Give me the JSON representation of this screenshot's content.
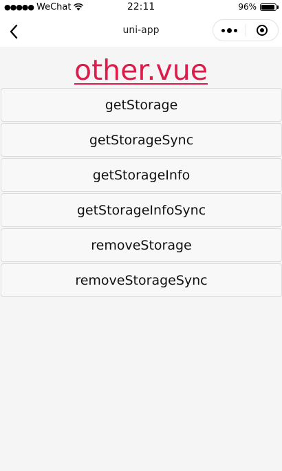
{
  "status_bar": {
    "carrier": "WeChat",
    "time": "22:11",
    "battery_percent": "96%",
    "battery_level": 0.96
  },
  "nav_bar": {
    "title": "uni-app",
    "back_icon": "chevron-left-icon",
    "more_icon": "more-dots-icon",
    "close_icon": "target-close-icon"
  },
  "page": {
    "heading": "other.vue",
    "heading_color": "#dd1c4b",
    "buttons": [
      "getStorage",
      "getStorageSync",
      "getStorageInfo",
      "getStorageInfoSync",
      "removeStorage",
      "removeStorageSync"
    ]
  }
}
